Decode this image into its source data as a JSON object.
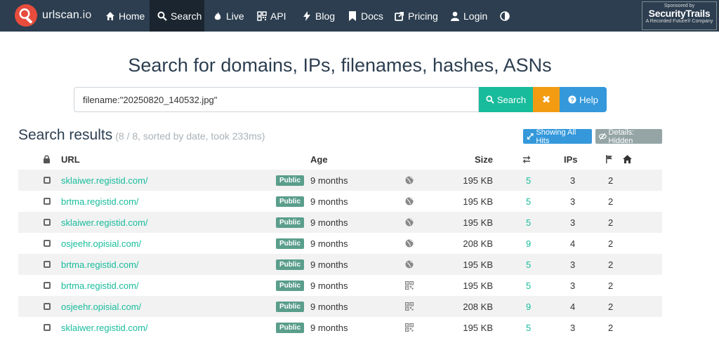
{
  "nav": {
    "brand_name": "urlscan",
    "brand_tld": ".io",
    "items": [
      {
        "label": "Home",
        "icon": "home-icon"
      },
      {
        "label": "Search",
        "icon": "search-icon"
      },
      {
        "label": "Live",
        "icon": "fire-icon"
      },
      {
        "label": "API",
        "icon": "qrcode-icon"
      },
      {
        "label": "Blog",
        "icon": "bolt-icon"
      },
      {
        "label": "Docs",
        "icon": "bookmark-icon"
      },
      {
        "label": "Pricing",
        "icon": "external-link-icon"
      },
      {
        "label": "Login",
        "icon": "user-icon"
      }
    ],
    "theme_toggle_icon": "contrast-icon",
    "sponsor": {
      "line1": "Sponsored by",
      "line2": "SecurityTrails",
      "line3": "A Recorded Future® Company"
    }
  },
  "headline": "Search for domains, IPs, filenames, hashes, ASNs",
  "search": {
    "value": "filename:\"20250820_140532.jpg\"",
    "search_label": "Search",
    "clear_label": "✖",
    "help_label": "Help"
  },
  "results": {
    "title": "Search results",
    "meta": "(8 / 8, sorted by date, took 233ms)",
    "showing_all_hits": "Showing All Hits",
    "details_hidden": "Details: Hidden",
    "columns": {
      "url": "URL",
      "age": "Age",
      "size": "Size",
      "ips": "IPs"
    },
    "rows": [
      {
        "url": "sklaiwer.registid.com/",
        "visibility": "Public",
        "age": "9 months",
        "icon": "globe-icon",
        "size": "195 KB",
        "requests": "5",
        "ips": "3",
        "countries": "2"
      },
      {
        "url": "brtma.registid.com/",
        "visibility": "Public",
        "age": "9 months",
        "icon": "globe-icon",
        "size": "195 KB",
        "requests": "5",
        "ips": "3",
        "countries": "2"
      },
      {
        "url": "sklaiwer.registid.com/",
        "visibility": "Public",
        "age": "9 months",
        "icon": "globe-icon",
        "size": "195 KB",
        "requests": "5",
        "ips": "3",
        "countries": "2"
      },
      {
        "url": "osjeehr.opisial.com/",
        "visibility": "Public",
        "age": "9 months",
        "icon": "globe-icon",
        "size": "208 KB",
        "requests": "9",
        "ips": "4",
        "countries": "2"
      },
      {
        "url": "brtma.registid.com/",
        "visibility": "Public",
        "age": "9 months",
        "icon": "globe-icon",
        "size": "195 KB",
        "requests": "5",
        "ips": "3",
        "countries": "2"
      },
      {
        "url": "brtma.registid.com/",
        "visibility": "Public",
        "age": "9 months",
        "icon": "qrcode-icon",
        "size": "195 KB",
        "requests": "5",
        "ips": "3",
        "countries": "2"
      },
      {
        "url": "osjeehr.opisial.com/",
        "visibility": "Public",
        "age": "9 months",
        "icon": "qrcode-icon",
        "size": "208 KB",
        "requests": "9",
        "ips": "4",
        "countries": "2"
      },
      {
        "url": "sklaiwer.registid.com/",
        "visibility": "Public",
        "age": "9 months",
        "icon": "qrcode-icon",
        "size": "195 KB",
        "requests": "5",
        "ips": "3",
        "countries": "2"
      }
    ]
  },
  "colors": {
    "navbar": "#2c3e50",
    "accent_green": "#18bc9c",
    "accent_orange": "#f39c12",
    "accent_blue": "#3498db",
    "badge_public": "#5a9e8b"
  }
}
